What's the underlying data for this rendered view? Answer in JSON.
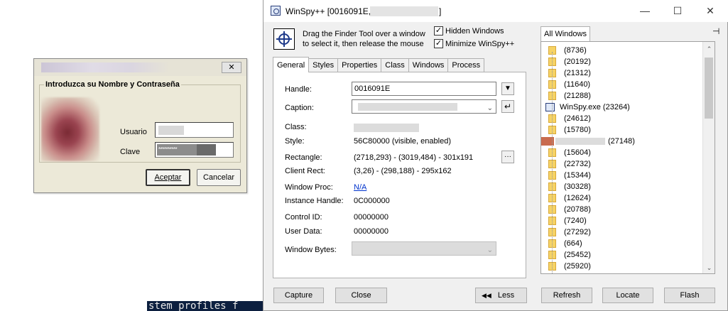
{
  "terminal": {
    "text": "stem profiles f"
  },
  "login": {
    "group_label": "Introduzca su Nombre y Contraseña",
    "close_glyph": "✕",
    "usuario_label": "Usuario",
    "clave_label": "Clave",
    "clave_value": "**********",
    "ok_button": "Aceptar",
    "cancel_button": "Cancelar"
  },
  "winspy": {
    "title": "WinSpy++ [0016091E,",
    "title_end": "]",
    "finder_line1": "Drag the Finder Tool over a window",
    "finder_line2": "to select it, then release the mouse",
    "hidden_windows": "Hidden Windows",
    "minimize_winspy": "Minimize WinSpy++",
    "check_glyph": "✓",
    "tabs": [
      "General",
      "Styles",
      "Properties",
      "Class",
      "Windows",
      "Process"
    ],
    "general": {
      "handle_label": "Handle:",
      "handle_value": "0016091E",
      "caption_label": "Caption:",
      "class_label": "Class:",
      "style_label": "Style:",
      "style_value": "56C80000  (visible, enabled)",
      "rectangle_label": "Rectangle:",
      "rectangle_value": "(2718,293) - (3019,484)  -  301x191",
      "client_rect_label": "Client Rect:",
      "client_rect_value": "(3,26) - (298,188)  -  295x162",
      "window_proc_label": "Window Proc:",
      "window_proc_value": "N/A",
      "instance_handle_label": "Instance Handle:",
      "instance_handle_value": "0C000000",
      "control_id_label": "Control ID:",
      "control_id_value": "00000000",
      "user_data_label": "User Data:",
      "user_data_value": "00000000",
      "window_bytes_label": "Window Bytes:"
    },
    "tree_tab": "All Windows",
    "tree_items": [
      "(8736)",
      "(20192)",
      "(21312)",
      "(11640)",
      "(21288)",
      "WinSpy.exe  (23264)",
      "(24612)",
      "(15780)",
      "(27148)",
      "(15604)",
      "(22732)",
      "(15344)",
      "(30328)",
      "(12624)",
      "(20788)",
      "(7240)",
      "(27292)",
      "(664)",
      "(25452)",
      "(25920)"
    ],
    "buttons": {
      "capture": "Capture",
      "close": "Close",
      "less": "Less",
      "refresh": "Refresh",
      "locate": "Locate",
      "flash": "Flash"
    },
    "window_controls": {
      "minimize": "—",
      "maximize": "☐",
      "close": "✕"
    }
  }
}
